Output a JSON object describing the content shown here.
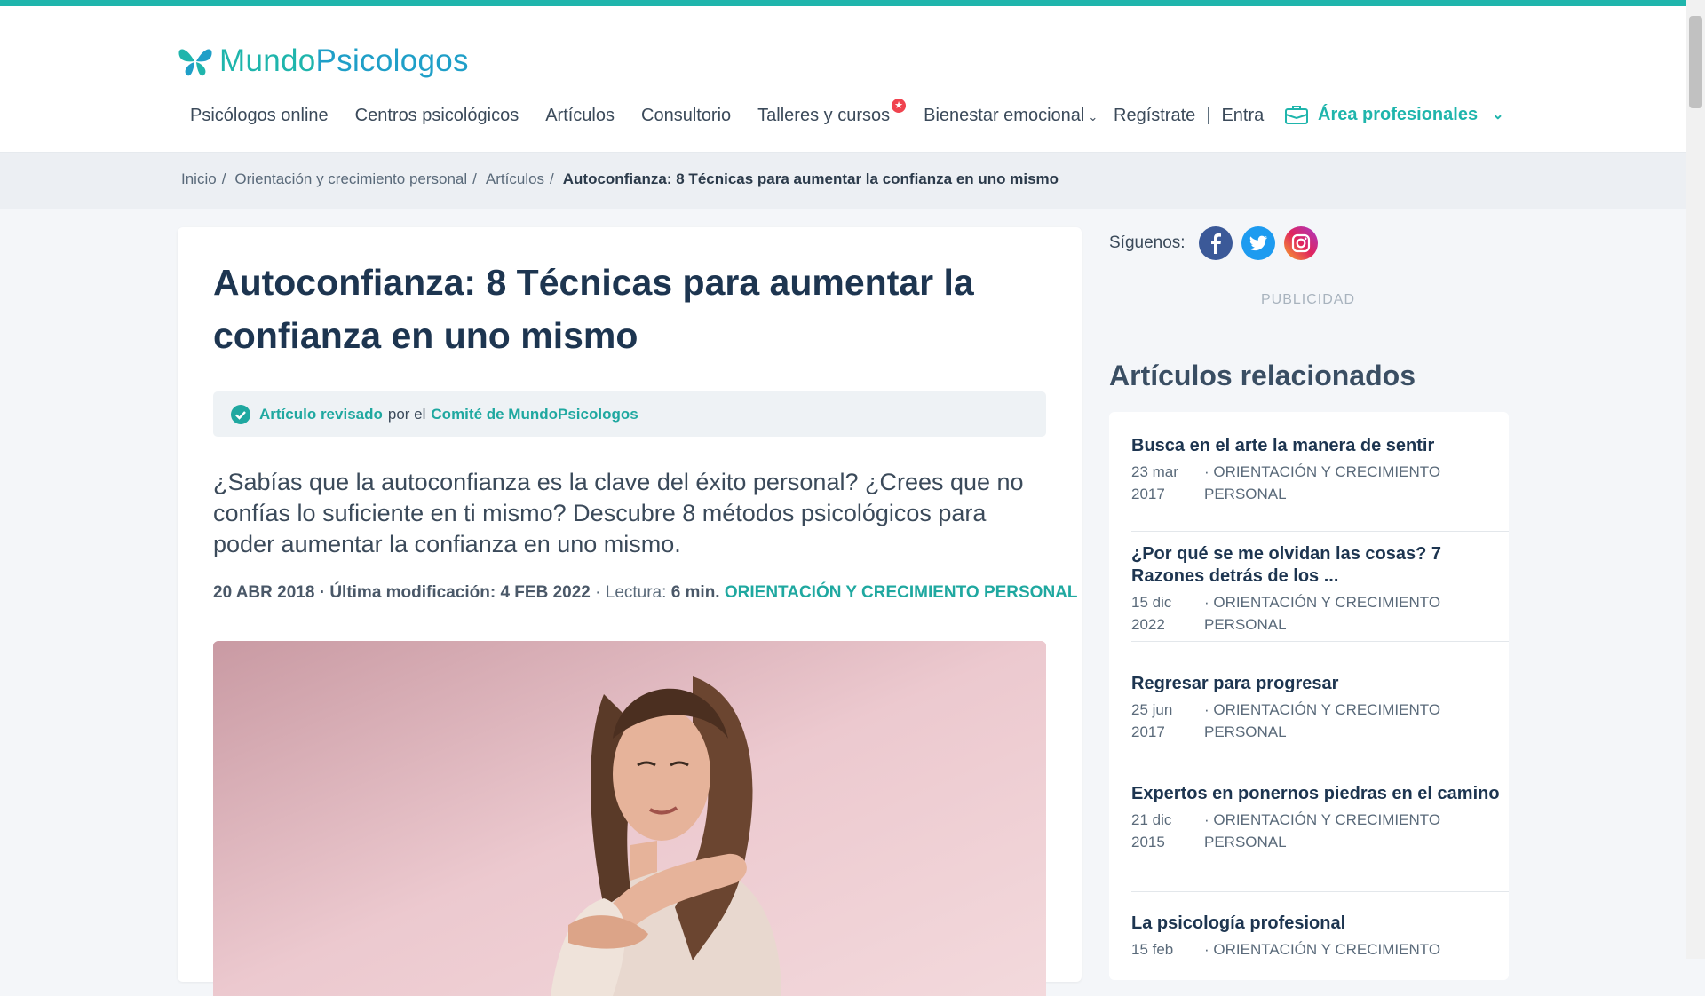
{
  "brand": {
    "name_part1": "Mundo",
    "name_part2": "Psicologos"
  },
  "nav": {
    "items": [
      "Psicólogos online",
      "Centros psicológicos",
      "Artículos",
      "Consultorio",
      "Talleres y cursos",
      "Bienestar emocional"
    ],
    "register": "Regístrate",
    "separator": "|",
    "login": "Entra",
    "pro_area": "Área profesionales"
  },
  "breadcrumb": {
    "items": [
      "Inicio",
      "Orientación y crecimiento personal",
      "Artículos"
    ],
    "current": "Autoconfianza: 8 Técnicas para aumentar la confianza en uno mismo"
  },
  "article": {
    "title": "Autoconfianza: 8 Técnicas para aumentar la confianza en uno mismo",
    "review": {
      "reviewed": "Artículo revisado",
      "by": "por el",
      "committee": "Comité de MundoPsicologos"
    },
    "lead": "¿Sabías que la autoconfianza es la clave del éxito personal? ¿Crees que no confías lo suficiente en ti mismo? Descubre 8 métodos psicológicos para poder aumentar la confianza en uno mismo.",
    "meta": {
      "date": "20 ABR 2018",
      "modified_label": "Última modificación:",
      "modified": "4 FEB 2022",
      "reading_label": "Lectura:",
      "reading": "6 min.",
      "category": "ORIENTACIÓN Y CRECIMIENTO PERSONAL"
    }
  },
  "sidebar": {
    "follow_label": "Síguenos:",
    "ad_label": "PUBLICIDAD",
    "related_heading": "Artículos relacionados",
    "related": [
      {
        "title": "Busca en el arte la manera de sentir",
        "date": "23 mar 2017",
        "category": "· Orientación y crecimiento personal"
      },
      {
        "title": "¿Por qué se me olvidan las cosas? 7 Razones detrás de los ...",
        "date": "15 dic 2022",
        "category": "· Orientación y crecimiento personal"
      },
      {
        "title": "Regresar para progresar",
        "date": "25 jun 2017",
        "category": "· Orientación y crecimiento personal"
      },
      {
        "title": "Expertos en ponernos piedras en el camino",
        "date": "21 dic 2015",
        "category": "· Orientación y crecimiento personal"
      },
      {
        "title": "La psicología profesional",
        "date": "15 feb",
        "category": "· Orientación y crecimiento"
      }
    ]
  },
  "colors": {
    "accent": "#1fb5ac",
    "title": "#1d3550",
    "badge": "#f0434f"
  }
}
